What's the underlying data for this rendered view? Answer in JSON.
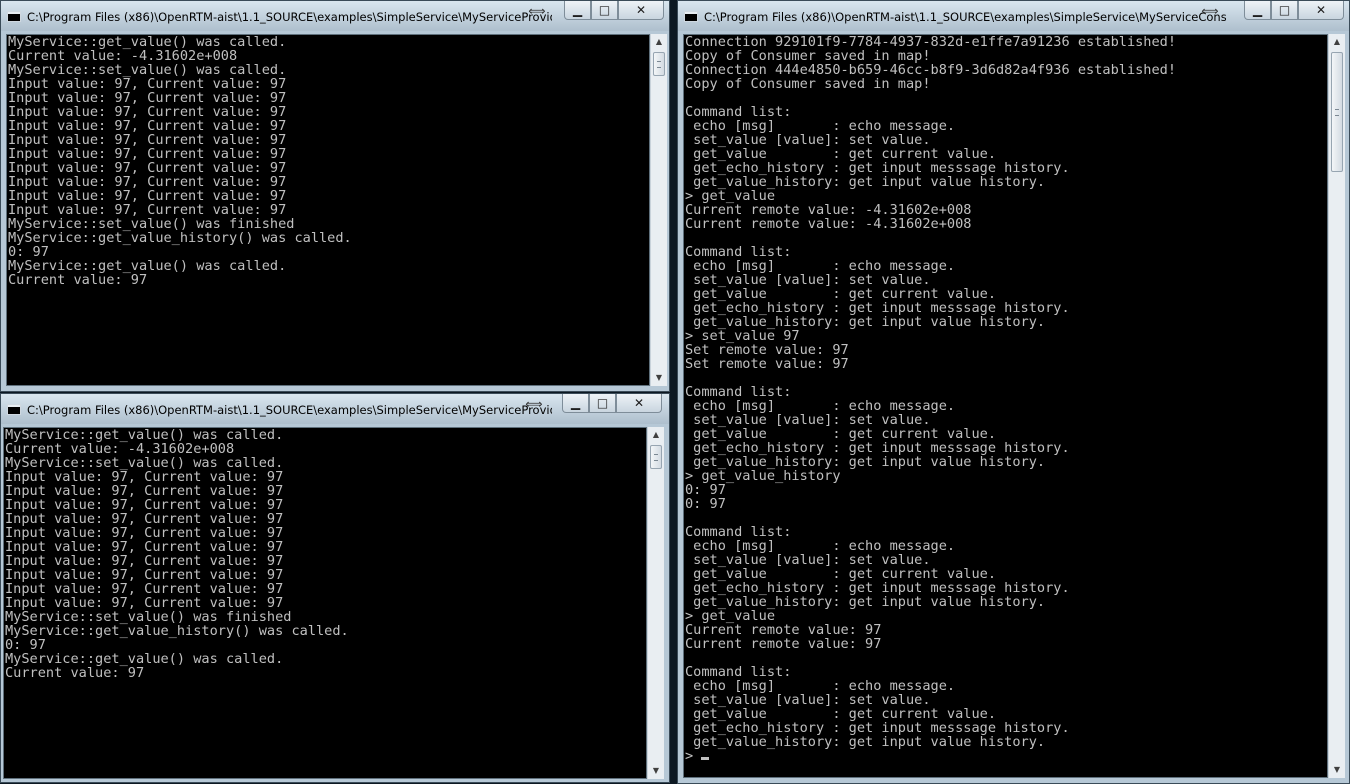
{
  "windows": {
    "provider_top": {
      "title": "C:\\Program Files (x86)\\OpenRTM-aist\\1.1_SOURCE\\examples\\SimpleService\\MyServiceProviderCo...",
      "lines": [
        "MyService::get_value() was called.",
        "Current value: -4.31602e+008",
        "MyService::set_value() was called.",
        "Input value: 97, Current value: 97",
        "Input value: 97, Current value: 97",
        "Input value: 97, Current value: 97",
        "Input value: 97, Current value: 97",
        "Input value: 97, Current value: 97",
        "Input value: 97, Current value: 97",
        "Input value: 97, Current value: 97",
        "Input value: 97, Current value: 97",
        "Input value: 97, Current value: 97",
        "Input value: 97, Current value: 97",
        "MyService::set_value() was finished",
        "MyService::get_value_history() was called.",
        "0: 97",
        "MyService::get_value() was called.",
        "Current value: 97"
      ]
    },
    "provider_bottom": {
      "title": "C:\\Program Files (x86)\\OpenRTM-aist\\1.1_SOURCE\\examples\\SimpleService\\MyServiceProviderCo...",
      "lines": [
        "MyService::get_value() was called.",
        "Current value: -4.31602e+008",
        "MyService::set_value() was called.",
        "Input value: 97, Current value: 97",
        "Input value: 97, Current value: 97",
        "Input value: 97, Current value: 97",
        "Input value: 97, Current value: 97",
        "Input value: 97, Current value: 97",
        "Input value: 97, Current value: 97",
        "Input value: 97, Current value: 97",
        "Input value: 97, Current value: 97",
        "Input value: 97, Current value: 97",
        "Input value: 97, Current value: 97",
        "MyService::set_value() was finished",
        "MyService::get_value_history() was called.",
        "0: 97",
        "MyService::get_value() was called.",
        "Current value: 97"
      ]
    },
    "consumer": {
      "title": "C:\\Program Files (x86)\\OpenRTM-aist\\1.1_SOURCE\\examples\\SimpleService\\MyServiceConsumerCo...",
      "lines": [
        "Connection 929101f9-7784-4937-832d-e1ffe7a91236 established!",
        "Copy of Consumer saved in map!",
        "Connection 444e4850-b659-46cc-b8f9-3d6d82a4f936 established!",
        "Copy of Consumer saved in map!",
        "",
        "Command list:",
        " echo [msg]       : echo message.",
        " set_value [value]: set value.",
        " get_value        : get current value.",
        " get_echo_history : get input messsage history.",
        " get_value_history: get input value history.",
        "> get_value",
        "Current remote value: -4.31602e+008",
        "Current remote value: -4.31602e+008",
        "",
        "Command list:",
        " echo [msg]       : echo message.",
        " set_value [value]: set value.",
        " get_value        : get current value.",
        " get_echo_history : get input messsage history.",
        " get_value_history: get input value history.",
        "> set_value 97",
        "Set remote value: 97",
        "Set remote value: 97",
        "",
        "Command list:",
        " echo [msg]       : echo message.",
        " set_value [value]: set value.",
        " get_value        : get current value.",
        " get_echo_history : get input messsage history.",
        " get_value_history: get input value history.",
        "> get_value_history",
        "0: 97",
        "0: 97",
        "",
        "Command list:",
        " echo [msg]       : echo message.",
        " set_value [value]: set value.",
        " get_value        : get current value.",
        " get_echo_history : get input messsage history.",
        " get_value_history: get input value history.",
        "> get_value",
        "Current remote value: 97",
        "Current remote value: 97",
        "",
        "Command list:",
        " echo [msg]       : echo message.",
        " set_value [value]: set value.",
        " get_value        : get current value.",
        " get_echo_history : get input messsage history.",
        " get_value_history: get input value history."
      ],
      "prompt": "> "
    }
  },
  "controls": {
    "minimize": "▁",
    "maximize": "□",
    "close": "✕",
    "resize": "⟺"
  },
  "colors": {
    "console_bg": "#000000",
    "console_text": "#c0c0c0",
    "frame": "#b6c8d6"
  }
}
